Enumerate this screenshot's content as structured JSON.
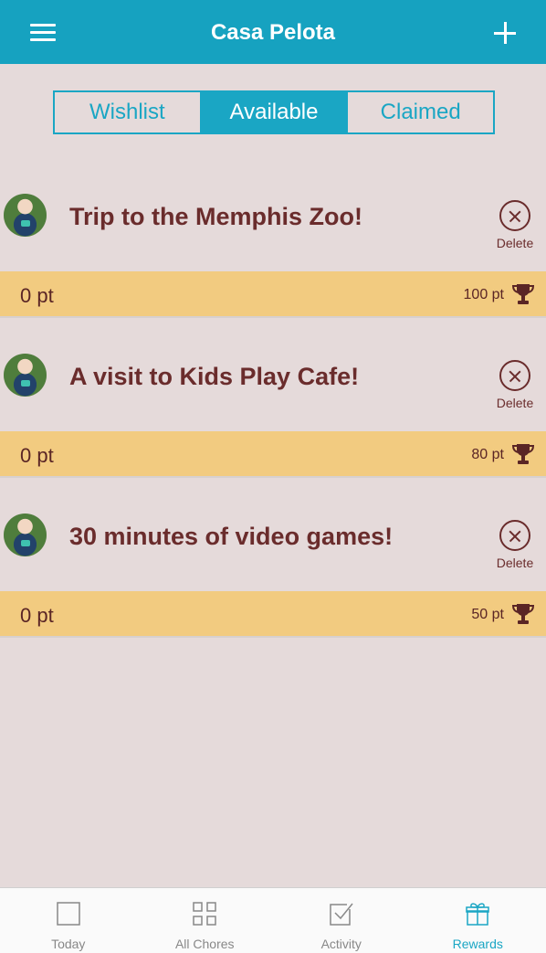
{
  "header": {
    "title": "Casa Pelota",
    "menu_icon": "menu-icon",
    "add_icon": "plus-icon"
  },
  "tabs": [
    {
      "label": "Wishlist",
      "active": false
    },
    {
      "label": "Available",
      "active": true
    },
    {
      "label": "Claimed",
      "active": false
    }
  ],
  "rewards": [
    {
      "name": "Trip to the Memphis Zoo!",
      "earned": "0 pt",
      "cost": "100 pt",
      "delete_label": "Delete"
    },
    {
      "name": "A visit to Kids Play Cafe!",
      "earned": "0 pt",
      "cost": "80 pt",
      "delete_label": "Delete"
    },
    {
      "name": "30 minutes of video games!",
      "earned": "0 pt",
      "cost": "50 pt",
      "delete_label": "Delete"
    }
  ],
  "bottom_nav": [
    {
      "label": "Today",
      "icon": "square-icon",
      "active": false
    },
    {
      "label": "All Chores",
      "icon": "grid-icon",
      "active": false
    },
    {
      "label": "Activity",
      "icon": "checkbox-icon",
      "active": false
    },
    {
      "label": "Rewards",
      "icon": "gift-icon",
      "active": true
    }
  ],
  "colors": {
    "header": "#16a2c0",
    "accent": "#1aa6c4",
    "points_bar": "#f2cb80",
    "text_dark": "#6a2c2c",
    "background": "#e5dada"
  }
}
